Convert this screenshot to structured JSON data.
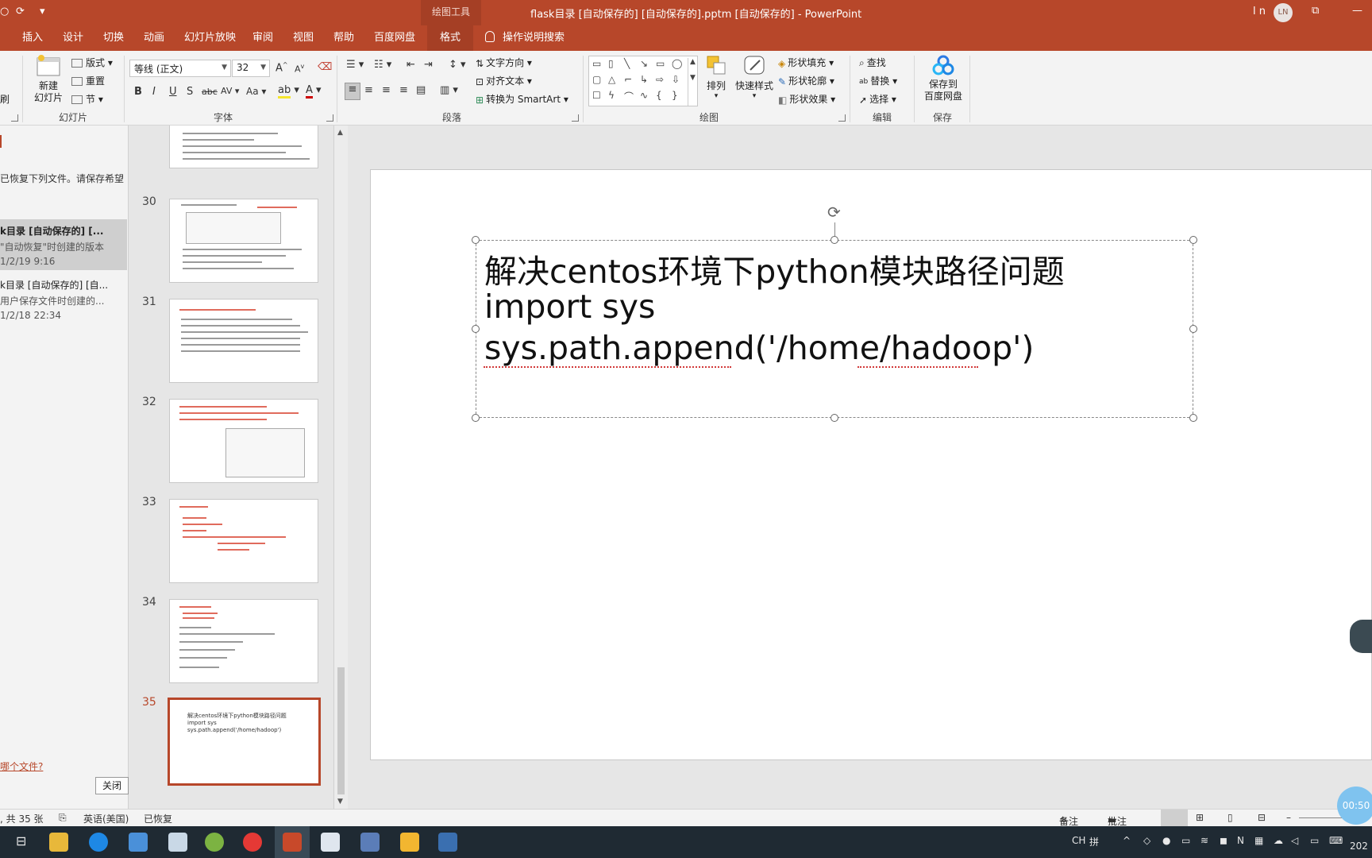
{
  "titlebar": {
    "context_tool": "绘图工具",
    "title": "flask目录 [自动保存的] [自动保存的].pptm [自动保存的]  -  PowerPoint",
    "user": "l n",
    "avatar": "LN",
    "qa_icons": [
      "autosave-icon",
      "touch-mode-icon",
      "customize-icon"
    ]
  },
  "ribbon_tabs": [
    "插入",
    "设计",
    "切换",
    "动画",
    "幻灯片放映",
    "审阅",
    "视图",
    "帮助",
    "百度网盘",
    "格式"
  ],
  "active_tab": "格式",
  "tell_me": "操作说明搜索",
  "ribbon": {
    "slides_group": {
      "label": "幻灯片",
      "new_slide": "新建\n幻灯片",
      "layout": "版式",
      "reset": "重置",
      "section": "节"
    },
    "clipboard_partial": "刷",
    "font_group": {
      "label": "字体",
      "font_name": "等线 (正文)",
      "font_size": "32",
      "bold": "B",
      "italic": "I",
      "underline": "U",
      "shadow": "S",
      "strike": "abc",
      "spacing": "AV",
      "case": "Aa",
      "grow": "A",
      "shrink": "A"
    },
    "paragraph_group": {
      "label": "段落",
      "text_direction": "文字方向",
      "align_text": "对齐文本",
      "smartart": "转换为 SmartArt"
    },
    "drawing_group": {
      "label": "绘图",
      "arrange": "排列",
      "quick_styles": "快速样式",
      "fill": "形状填充",
      "outline": "形状轮廓",
      "effects": "形状效果"
    },
    "editing_group": {
      "label": "编辑",
      "find": "查找",
      "replace": "替换",
      "select": "选择"
    },
    "save_group": {
      "label": "保存",
      "save_baidu": "保存到\n百度网盘"
    }
  },
  "recovery": {
    "message": "已恢复下列文件。请保存希望",
    "items": [
      {
        "title": "k目录 [自动保存的] [...",
        "desc": "\"自动恢复\"时创建的版本",
        "time": "1/2/19 9:16",
        "selected": true
      },
      {
        "title": "k目录 [自动保存的] [自...",
        "desc": "用户保存文件时创建的...",
        "time": "1/2/18 22:34",
        "selected": false
      }
    ],
    "link": "哪个文件?",
    "close": "关闭"
  },
  "slides": [
    {
      "number": "30"
    },
    {
      "number": "31"
    },
    {
      "number": "32"
    },
    {
      "number": "33"
    },
    {
      "number": "34"
    },
    {
      "number": "35",
      "lines": [
        "解决centos环境下python模块路径问题",
        "import sys",
        "sys.path.append('/home/hadoop')"
      ],
      "active": true
    }
  ],
  "slide_content": {
    "lines": [
      "解决centos环境下python模块路径问题",
      "import sys",
      "sys.path.append('/home/hadoop')"
    ]
  },
  "statusbar": {
    "slide_info": ", 共 35 张",
    "language": "英语(美国)",
    "recovered": "已恢复",
    "notes": "备注",
    "comments": "批注"
  },
  "timer": "00:50",
  "taskbar": {
    "tray_lang": "CH",
    "tray_ime": "拼",
    "clock_partial": "202"
  }
}
